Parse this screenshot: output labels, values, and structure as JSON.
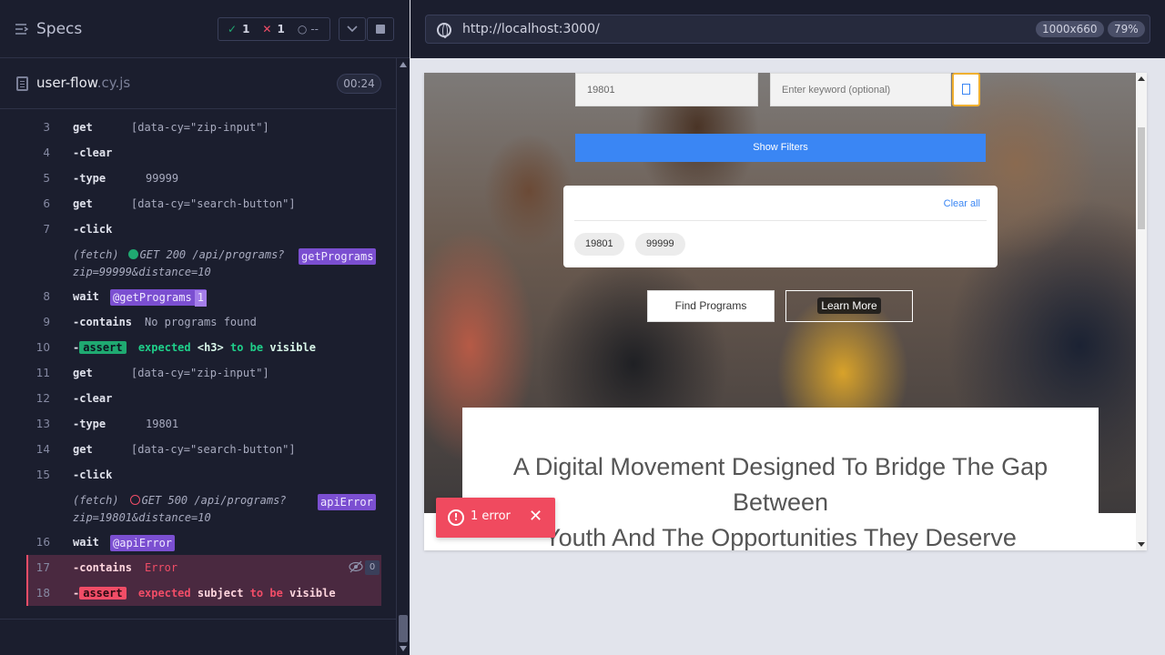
{
  "header": {
    "specs_label": "Specs",
    "stats": {
      "passed": "1",
      "failed": "1",
      "pending": "--"
    }
  },
  "file": {
    "name": "user-flow",
    "ext": ".cy.js",
    "duration": "00:24"
  },
  "commands": [
    {
      "num": "3",
      "name": "get",
      "arg": "[data-cy=\"zip-input\"]"
    },
    {
      "num": "4",
      "name": "-clear"
    },
    {
      "num": "5",
      "name": "-type",
      "arg": "99999"
    },
    {
      "num": "6",
      "name": "get",
      "arg": "[data-cy=\"search-button\"]"
    },
    {
      "num": "7",
      "name": "-click"
    },
    {
      "num": "8",
      "name": "wait",
      "alias": "@getPrograms",
      "alias_count": "1"
    },
    {
      "num": "9",
      "name": "-contains",
      "arg": "No programs found"
    },
    {
      "num": "10",
      "name": "-",
      "badge": "assert",
      "expected": "expected",
      "subject": "<h3>",
      "to_be": "to be",
      "value": "visible"
    },
    {
      "num": "11",
      "name": "get",
      "arg": "[data-cy=\"zip-input\"]"
    },
    {
      "num": "12",
      "name": "-clear"
    },
    {
      "num": "13",
      "name": "-type",
      "arg": "19801"
    },
    {
      "num": "14",
      "name": "get",
      "arg": "[data-cy=\"search-button\"]"
    },
    {
      "num": "15",
      "name": "-click"
    },
    {
      "num": "16",
      "name": "wait",
      "alias": "@apiError"
    },
    {
      "num": "17",
      "name": "-contains",
      "arg": "Error",
      "hidden_count": "0"
    },
    {
      "num": "18",
      "name": "-",
      "badge": "assert",
      "expected": "expected",
      "subject": "subject",
      "to_be": "to be",
      "value": "visible"
    }
  ],
  "fetches": [
    {
      "label": "(fetch)",
      "line1": "GET 200 /api/programs?",
      "line2": "zip=99999&distance=10",
      "alias": "getPrograms"
    },
    {
      "label": "(fetch)",
      "line1": "GET 500 /api/programs?",
      "line2": "zip=19801&distance=10",
      "alias": "apiError"
    }
  ],
  "aut": {
    "url": "http://localhost:3000/",
    "viewport": "1000x660",
    "zoom": "79%",
    "zip_value": "19801",
    "keyword_placeholder": "Enter keyword (optional)",
    "show_filters": "Show Filters",
    "clear_all": "Clear all",
    "chips": [
      "19801",
      "99999"
    ],
    "find_programs": "Find Programs",
    "learn_more": "Learn More",
    "headline_line1": "A Digital Movement Designed To Bridge The Gap",
    "headline_line2": "Between",
    "headline_line3": "Youth And The Opportunities They Deserve"
  },
  "error_toast": {
    "label": "1 error"
  },
  "colors": {
    "pass": "#1fa971",
    "fail": "#f14d67",
    "alias": "#7b4fd1",
    "accent": "#3a86f4"
  }
}
